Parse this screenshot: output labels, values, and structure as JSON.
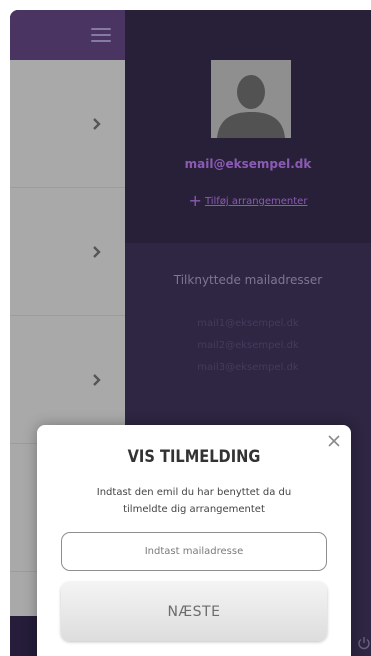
{
  "profile": {
    "email": "mail@eksempel.dk",
    "add_events_label": "Tilføj arrangementer"
  },
  "linked": {
    "title": "Tilknyttede mailadresser",
    "emails": [
      "mail1@eksempel.dk",
      "mail2@eksempel.dk",
      "mail3@eksempel.dk"
    ]
  },
  "modal": {
    "title": "VIS TILMELDING",
    "description": "Indtast den emil du har benyttet da du tilmeldte dig arrangementet",
    "input_placeholder": "Indtast mailadresse",
    "next_label": "NÆSTE"
  },
  "icons": [
    "menu-icon",
    "chevron-right-icon",
    "avatar-silhouette-icon",
    "plus-icon",
    "close-icon",
    "power-icon"
  ],
  "colors": {
    "accent_purple": "#8b5bb4",
    "header_purple": "#4a3562",
    "dark_panel": "#282038"
  }
}
